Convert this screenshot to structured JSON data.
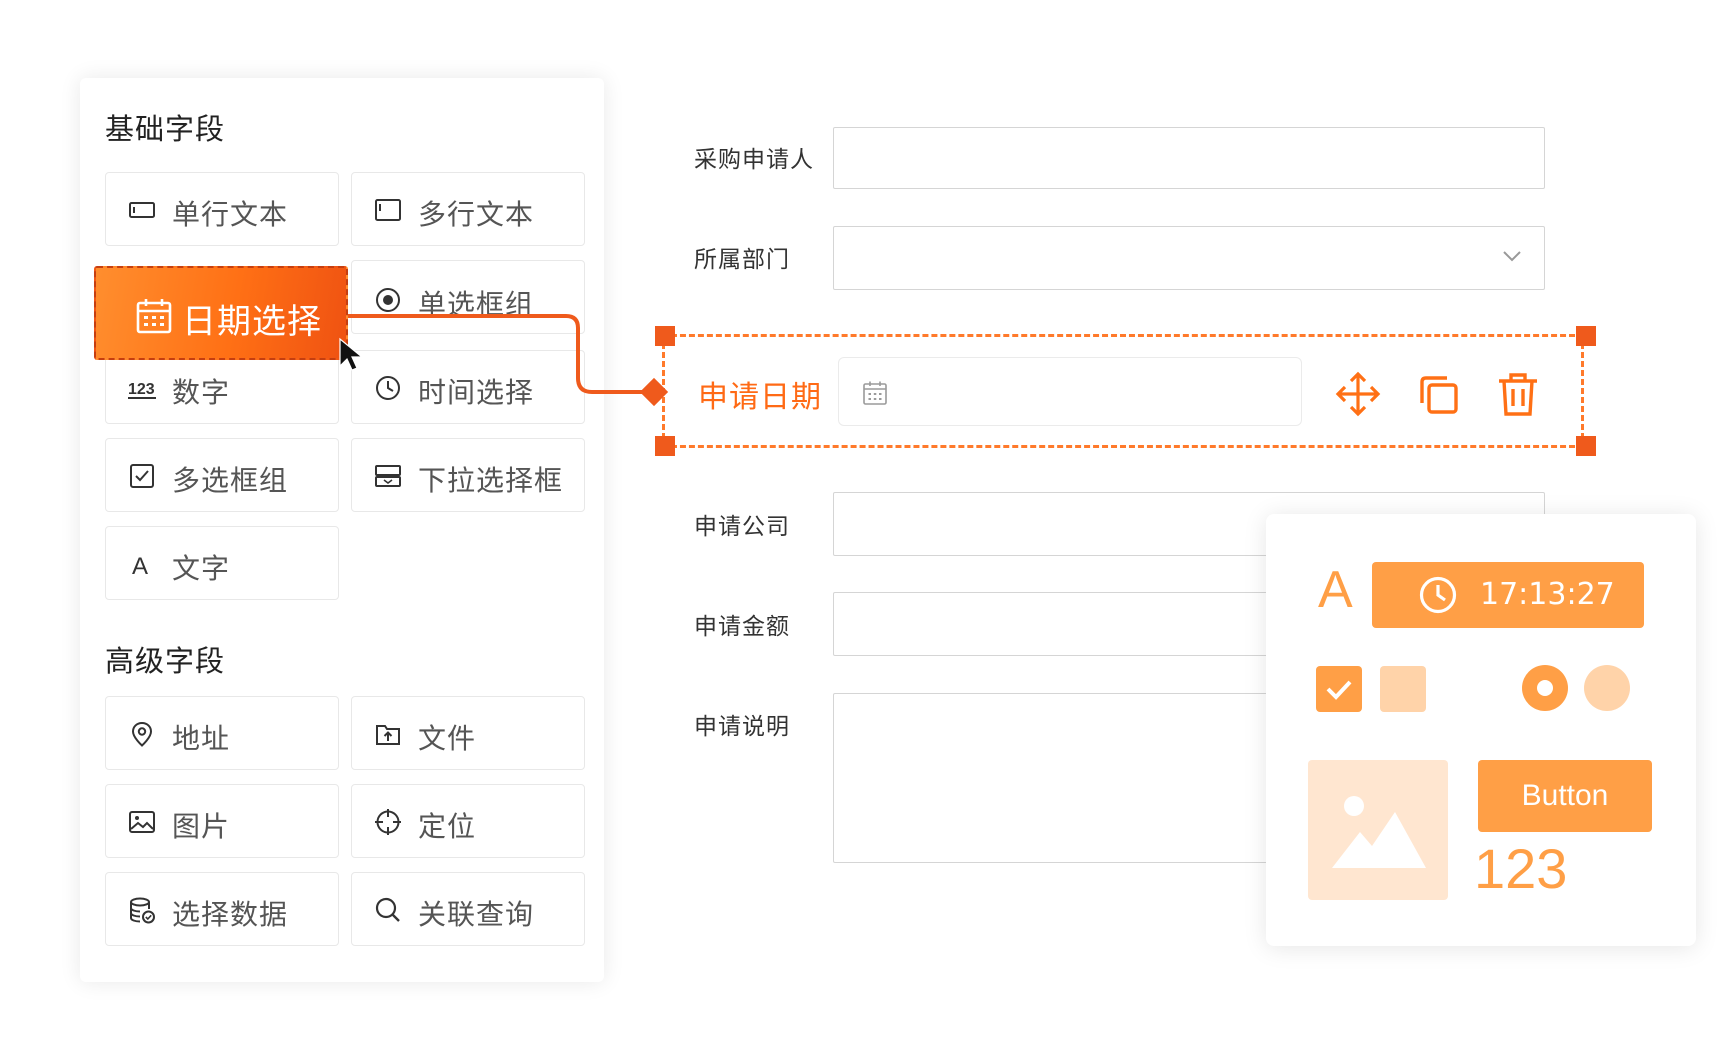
{
  "palette": {
    "basic_title": "基础字段",
    "basic_items": [
      {
        "label": "单行文本",
        "icon": "single-line-text-icon"
      },
      {
        "label": "多行文本",
        "icon": "multi-line-text-icon"
      },
      {
        "label": "单选框组",
        "icon": "radio-group-icon"
      },
      {
        "label": "数字",
        "icon": "number-icon"
      },
      {
        "label": "时间选择",
        "icon": "clock-icon"
      },
      {
        "label": "多选框组",
        "icon": "checkbox-group-icon"
      },
      {
        "label": "下拉选择框",
        "icon": "dropdown-select-icon"
      },
      {
        "label": "文字",
        "icon": "text-icon"
      }
    ],
    "dragging": {
      "label": "日期选择",
      "icon": "calendar-icon"
    },
    "advanced_title": "高级字段",
    "advanced_items": [
      {
        "label": "地址",
        "icon": "location-pin-icon"
      },
      {
        "label": "文件",
        "icon": "file-upload-icon"
      },
      {
        "label": "图片",
        "icon": "image-icon"
      },
      {
        "label": "定位",
        "icon": "crosshair-icon"
      },
      {
        "label": "选择数据",
        "icon": "database-icon"
      },
      {
        "label": "关联查询",
        "icon": "search-icon"
      }
    ]
  },
  "form": {
    "fields": [
      {
        "label": "采购申请人",
        "value": ""
      },
      {
        "label": "所属部门",
        "value": ""
      },
      {
        "label": "申请公司",
        "value": ""
      },
      {
        "label": "申请金额",
        "value": ""
      },
      {
        "label": "申请说明",
        "value": ""
      }
    ],
    "selected_field": {
      "label": "申请日期",
      "value": ""
    }
  },
  "widgets": {
    "text_glyph": "A",
    "time_value": "17:13:27",
    "button_label": "Button",
    "number_value": "123"
  },
  "colors": {
    "accent": "#ff7015",
    "accent_light": "#ff9f46",
    "accent_pale": "#ffd3a9"
  }
}
